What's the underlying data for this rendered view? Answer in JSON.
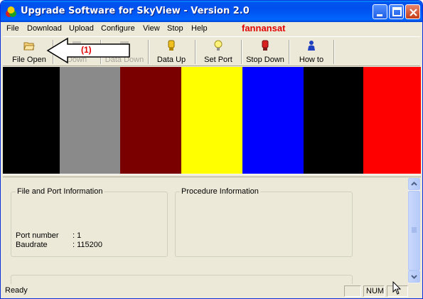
{
  "window": {
    "title": "Upgrade Software for SkyView - Version 2.0",
    "brand": "fannansat"
  },
  "menu": [
    "File",
    "Download",
    "Upload",
    "Configure",
    "View",
    "Stop",
    "Help"
  ],
  "toolbar": {
    "buttons": [
      {
        "label": "File Open",
        "icon": "folder-open-icon",
        "enabled": true
      },
      {
        "label": "Down",
        "icon": "download-icon",
        "enabled": false
      },
      {
        "label": "Data Down",
        "icon": "data-down-icon",
        "enabled": false
      },
      {
        "label": "Data Up",
        "icon": "data-up-icon",
        "enabled": true
      },
      {
        "label": "Set Port",
        "icon": "lightbulb-icon",
        "enabled": true
      },
      {
        "label": "Stop Down",
        "icon": "stop-icon",
        "enabled": true
      },
      {
        "label": "How to",
        "icon": "help-person-icon",
        "enabled": true
      }
    ]
  },
  "annotation": {
    "label": "(1)"
  },
  "color_bars": [
    "#000000",
    "#8a8a8a",
    "#7a0000",
    "#ffff00",
    "#0000ff",
    "#000000",
    "#ff0000"
  ],
  "file_port_info": {
    "title": "File and Port Information",
    "rows": [
      {
        "key": "Port number",
        "value": ": 1"
      },
      {
        "key": "Baudrate",
        "value": ": 115200"
      }
    ]
  },
  "procedure_info": {
    "title": "Procedure Information"
  },
  "statusbar": {
    "text": "Ready",
    "num": "NUM"
  }
}
